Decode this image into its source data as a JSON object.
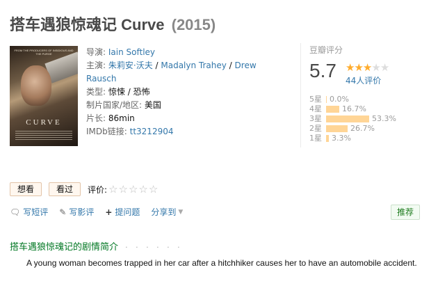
{
  "movie": {
    "title_zh": "搭车遇狼惊魂记",
    "title_en": "Curve",
    "year": "(2015)"
  },
  "poster": {
    "top_text": "FROM THE PRODUCERS OF INSIDIOUS AND THE PURGE",
    "title_text": "CURVE"
  },
  "info": {
    "director_label": "导演:",
    "director": "Iain Softley",
    "cast_label": "主演:",
    "cast": [
      "朱莉安·沃夫",
      "Madalyn Trahey",
      "Drew Rausch"
    ],
    "genre_label": "类型:",
    "genres": [
      "惊悚",
      "恐怖"
    ],
    "country_label": "制片国家/地区:",
    "country": "美国",
    "runtime_label": "片长:",
    "runtime": "86min",
    "imdb_label": "IMDb链接:",
    "imdb": "tt3212904"
  },
  "rating": {
    "title": "豆瓣评分",
    "score": "5.7",
    "stars_filled": 3,
    "stars_total": 5,
    "people": "44人评价",
    "distribution": [
      {
        "label": "5星",
        "pct": "0.0%",
        "value": 0.0
      },
      {
        "label": "4星",
        "pct": "16.7%",
        "value": 16.7
      },
      {
        "label": "3星",
        "pct": "53.3%",
        "value": 53.3
      },
      {
        "label": "2星",
        "pct": "26.7%",
        "value": 26.7
      },
      {
        "label": "1星",
        "pct": "3.3%",
        "value": 3.3
      }
    ],
    "bar_color": "#ffd596",
    "star_color": "#ffac2d"
  },
  "buttons": {
    "want": "想看",
    "seen": "看过",
    "rate_label": "评价:",
    "rate_stars": "☆☆☆☆☆"
  },
  "actions": {
    "short_review": "写短评",
    "review": "写影评",
    "question": "提问题",
    "share": "分享到",
    "recommend": "推荐"
  },
  "synopsis": {
    "heading": "搭车遇狼惊魂记的剧情简介",
    "dots": "· · · · · ·",
    "text": "A young woman becomes trapped in her car after a hitchhiker causes her to have an automobile accident."
  },
  "icons": {
    "short_review": "speech-bubble-icon",
    "review": "pencil-icon",
    "question": "plus-icon",
    "share_caret": "caret-down-icon"
  },
  "colors": {
    "link": "#3377aa",
    "synopsis_heading": "#007722",
    "title": "#494949"
  }
}
